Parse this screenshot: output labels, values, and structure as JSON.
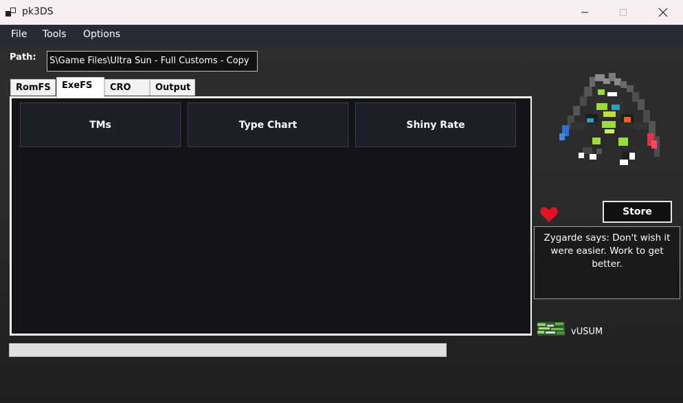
{
  "window": {
    "title": "pk3DS",
    "controls": {
      "minimize": "—",
      "maximize": "☐",
      "close": "✕"
    }
  },
  "menu": [
    "File",
    "Tools",
    "Options"
  ],
  "path": {
    "label": "Path:",
    "value": "S\\Game Files\\Ultra Sun - Full Customs - Copy"
  },
  "tabs": [
    {
      "label": "RomFS",
      "active": false
    },
    {
      "label": "ExeFS",
      "active": true
    },
    {
      "label": "CRO",
      "active": false
    },
    {
      "label": "Output",
      "active": false
    }
  ],
  "exefs_buttons": [
    "TMs",
    "Type Chart",
    "Shiny Rate"
  ],
  "progress": {
    "value": 0
  },
  "sidebar": {
    "sprite_icon": "zygarde-sprite-icon",
    "heart_icon": "heart-icon",
    "store_label": "Store",
    "speech": "Zygarde says: Don't wish it were easier. Work to get better.",
    "version": "vUSUM"
  },
  "colors": {
    "titlebar": "#f8eef4",
    "menubar": "#272b35",
    "panel": "#131318",
    "button": "#1c1e28",
    "heart": "#e81123"
  }
}
